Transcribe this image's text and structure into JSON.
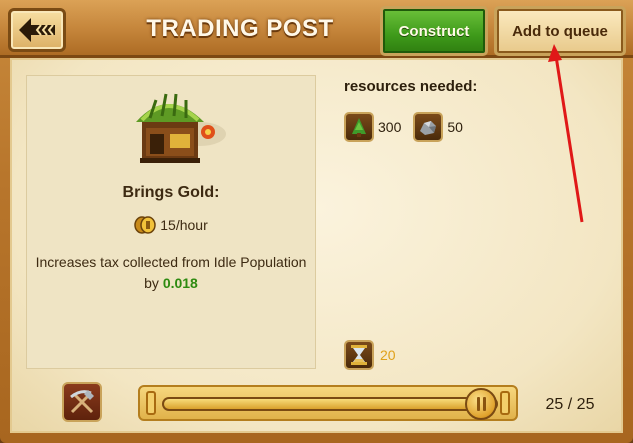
{
  "header": {
    "title": "TRADING POST",
    "construct_label": "Construct",
    "queue_label": "Add to queue"
  },
  "info": {
    "brings_label": "Brings Gold:",
    "rate": "15/hour",
    "description_prefix": "Increases tax collected from Idle Population by",
    "description_value": "0.018"
  },
  "resources": {
    "title": "resources needed:",
    "items": [
      {
        "icon": "wood-icon",
        "amount": "300"
      },
      {
        "icon": "stone-icon",
        "amount": "50"
      }
    ],
    "time": "20"
  },
  "slider": {
    "progress": 0.95,
    "count_label": "25 / 25"
  },
  "colors": {
    "construct_green": "#3e9a1a",
    "value_green": "#2d8a10",
    "time_orange": "#e0a11a",
    "annotation_red": "#e01818"
  }
}
